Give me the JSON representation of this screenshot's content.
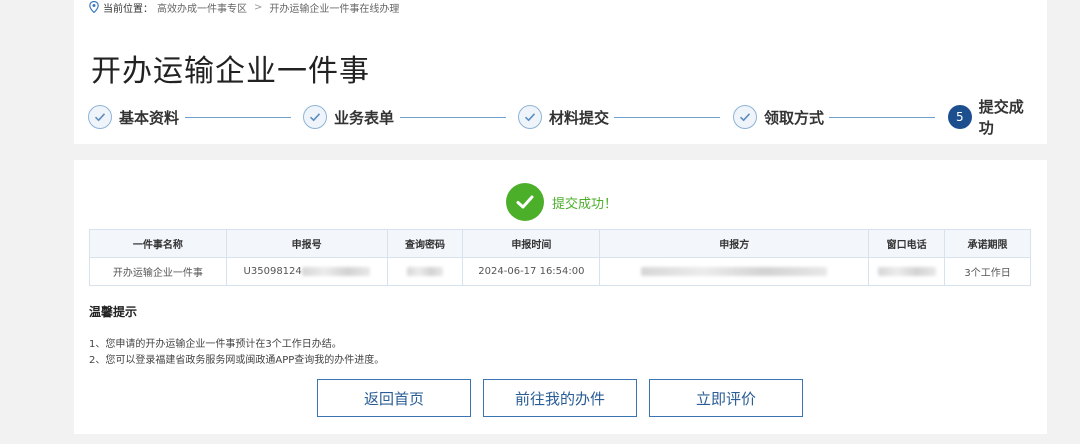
{
  "breadcrumb": {
    "label": "当前位置：",
    "items": [
      "高效办成一件事专区",
      "开办运输企业一件事在线办理"
    ],
    "separator": ">"
  },
  "page_title": "开办运输企业一件事",
  "steps": [
    {
      "label": "基本资料",
      "state": "done"
    },
    {
      "label": "业务表单",
      "state": "done"
    },
    {
      "label": "材料提交",
      "state": "done"
    },
    {
      "label": "领取方式",
      "state": "done"
    },
    {
      "label": "提交成功",
      "state": "active",
      "number": "5"
    }
  ],
  "success_message": "提交成功！",
  "table": {
    "headers": [
      "一件事名称",
      "申报号",
      "查询密码",
      "申报时间",
      "申报方",
      "窗口电话",
      "承诺期限"
    ],
    "row": {
      "name": "开办运输企业一件事",
      "apply_no_visible": "U35098124",
      "time": "2024-06-17 16:54:00",
      "deadline": "3个工作日"
    }
  },
  "tips": {
    "title": "温馨提示",
    "items": [
      "1、您申请的开办运输企业一件事预计在3个工作日办结。",
      "2、您可以登录福建省政务服务网或闽政通APP查询我的办件进度。"
    ]
  },
  "buttons": {
    "home": "返回首页",
    "my_items": "前往我的办件",
    "rate": "立即评价"
  },
  "colors": {
    "accent": "#1d4f8f",
    "success": "#4caf2a",
    "step_line": "#6fa0cf"
  }
}
